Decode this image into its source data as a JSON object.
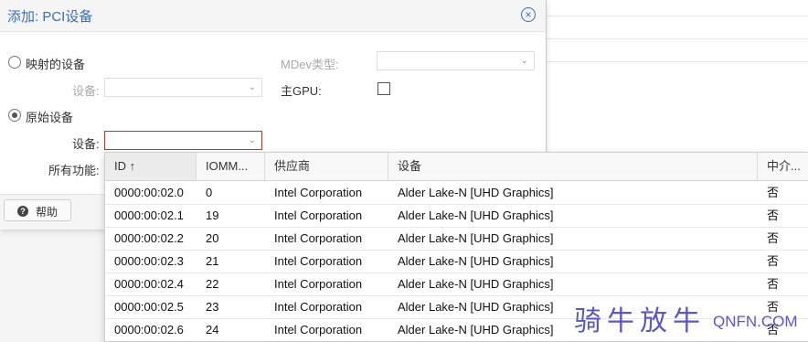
{
  "dialog": {
    "title": "添加: PCI设备",
    "mapped_device_label": "映射的设备",
    "raw_device_label": "原始设备",
    "device_label_1": "设备:",
    "device_label_2": "设备:",
    "all_functions_label": "所有功能:",
    "mdev_label": "MDev类型:",
    "primary_gpu_label": "主GPU:",
    "help_label": "帮助"
  },
  "grid": {
    "columns": [
      "ID ↑",
      "IOMM...",
      "供应商",
      "设备",
      "中介..."
    ],
    "rows": [
      [
        "0000:00:02.0",
        "0",
        "Intel Corporation",
        "Alder Lake-N [UHD Graphics]",
        "否"
      ],
      [
        "0000:00:02.1",
        "19",
        "Intel Corporation",
        "Alder Lake-N [UHD Graphics]",
        "否"
      ],
      [
        "0000:00:02.2",
        "20",
        "Intel Corporation",
        "Alder Lake-N [UHD Graphics]",
        "否"
      ],
      [
        "0000:00:02.3",
        "21",
        "Intel Corporation",
        "Alder Lake-N [UHD Graphics]",
        "否"
      ],
      [
        "0000:00:02.4",
        "22",
        "Intel Corporation",
        "Alder Lake-N [UHD Graphics]",
        "否"
      ],
      [
        "0000:00:02.5",
        "23",
        "Intel Corporation",
        "Alder Lake-N [UHD Graphics]",
        "否"
      ],
      [
        "0000:00:02.6",
        "24",
        "Intel Corporation",
        "Alder Lake-N [UHD Graphics]",
        "否"
      ]
    ]
  },
  "watermark": {
    "text": "骑牛放牛",
    "url": "QNFN.COM"
  }
}
